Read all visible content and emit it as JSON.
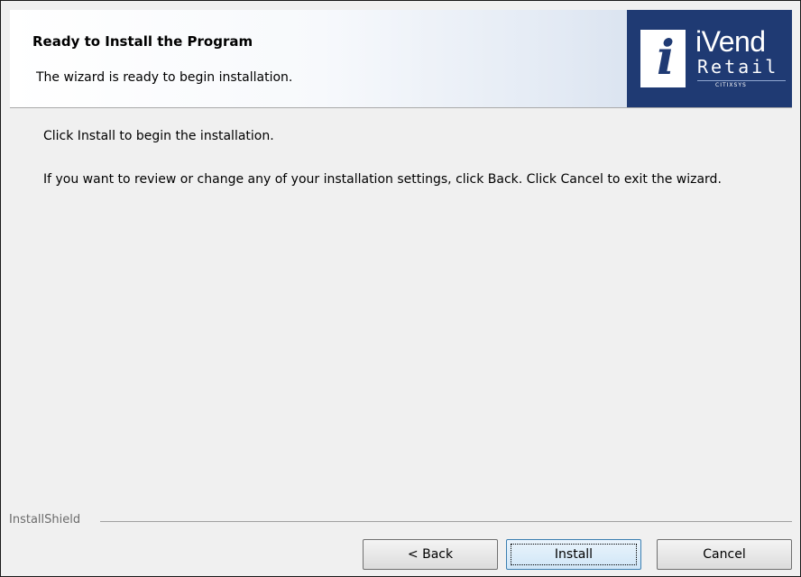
{
  "header": {
    "title": "Ready to Install the Program",
    "subtitle": "The wizard is ready to begin installation."
  },
  "logo": {
    "glyph": "i",
    "word": "iVend",
    "sub": "Retail",
    "tag": "CITIXSYS"
  },
  "content": {
    "line1": "Click Install to begin the installation.",
    "line2": "If you want to review or change any of your installation settings, click Back. Click Cancel to exit the wizard."
  },
  "footer": {
    "brand": "InstallShield"
  },
  "buttons": {
    "back": "< Back",
    "install": "Install",
    "cancel": "Cancel"
  },
  "colors": {
    "logo_bg": "#1f3a73",
    "dialog_bg": "#f0f0f0"
  }
}
